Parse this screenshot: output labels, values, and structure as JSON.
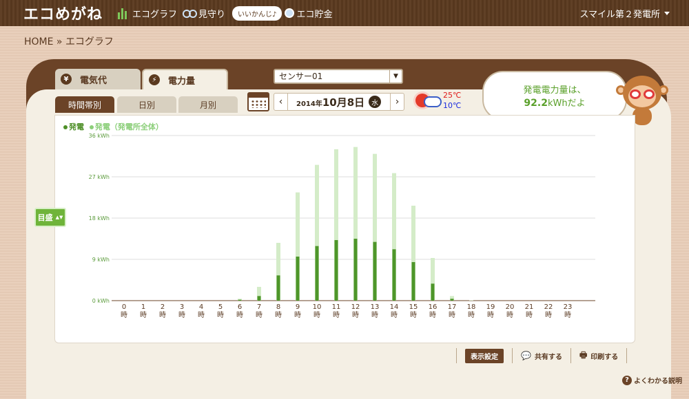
{
  "header": {
    "logo": "エコめがね",
    "nav": [
      {
        "label": "エコグラフ",
        "icon": "bar-chart-icon"
      },
      {
        "label": "見守り",
        "icon": "glasses-icon"
      },
      {
        "label": "エコ貯金",
        "icon": "coin-icon"
      }
    ],
    "bubble": "いいかんじ♪",
    "site": "スマイル第２発電所"
  },
  "breadcrumb": "HOME » エコグラフ",
  "tabs": {
    "denkidai": "電気代",
    "denryoku": "電力量",
    "denkidai_icon": "¥",
    "denryoku_icon": "⚡"
  },
  "sensor": {
    "value": "センサー01"
  },
  "period_tabs": {
    "jikan": "時間帯別",
    "hibetsu": "日別",
    "tsukibetsu": "月別"
  },
  "date": {
    "year": "2014年",
    "day": "10月8日",
    "weekday": "水"
  },
  "weather": {
    "high": "25℃",
    "low": "10℃"
  },
  "speech": {
    "line1": "発電電力量は、",
    "value": "92.2",
    "unit": "kWhだよ"
  },
  "legend": {
    "generation": "発電",
    "generation_all": "発電（発電所全体）"
  },
  "scale_button": "目盛",
  "toolbar": {
    "display_settings": "表示設定",
    "share": "共有する",
    "print": "印刷する"
  },
  "help": "よくわかる説明",
  "chart_data": {
    "type": "bar",
    "categories": [
      "0",
      "1",
      "2",
      "3",
      "4",
      "5",
      "6",
      "7",
      "8",
      "9",
      "10",
      "11",
      "12",
      "13",
      "14",
      "15",
      "16",
      "17",
      "18",
      "19",
      "20",
      "21",
      "22",
      "23"
    ],
    "category_suffix": "時",
    "ylim": [
      0,
      36
    ],
    "yticks": [
      "0 kWh",
      "9 kWh",
      "18 kWh",
      "27 kWh",
      "36 kWh"
    ],
    "ytick_values": [
      0,
      9,
      18,
      27,
      36
    ],
    "series": [
      {
        "name": "発電（発電所全体）",
        "color": "#d4ecc8",
        "values": [
          0,
          0,
          0,
          0,
          0,
          0,
          0.4,
          3.0,
          12.6,
          23.6,
          29.6,
          33.0,
          33.5,
          32.0,
          27.8,
          20.7,
          9.3,
          1.0,
          0.1,
          0,
          0,
          0,
          0,
          0
        ]
      },
      {
        "name": "発電",
        "color": "#4e962a",
        "values": [
          0,
          0,
          0,
          0,
          0,
          0,
          0.2,
          1.0,
          5.5,
          9.6,
          11.9,
          13.2,
          13.5,
          12.8,
          11.2,
          8.4,
          3.7,
          0.4,
          0,
          0,
          0,
          0,
          0,
          0
        ]
      }
    ]
  }
}
